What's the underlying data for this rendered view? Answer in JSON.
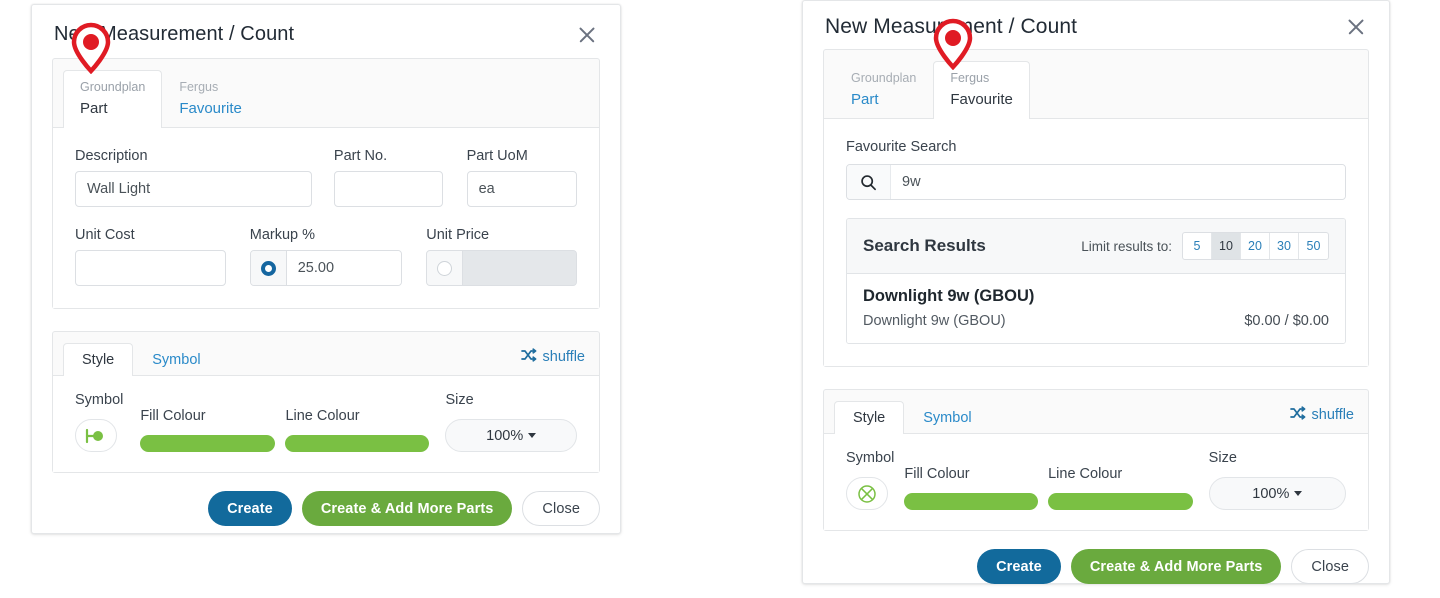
{
  "left_panel": {
    "title": "New Measurement / Count",
    "close_icon": "close-icon",
    "tabs": [
      {
        "sub": "Groundplan",
        "main": "Part",
        "active": true
      },
      {
        "sub": "Fergus",
        "main": "Favourite",
        "active": false
      }
    ],
    "form": {
      "description_label": "Description",
      "description_value": "Wall Light",
      "part_no_label": "Part No.",
      "part_no_value": "",
      "part_uom_label": "Part UoM",
      "part_uom_value": "ea",
      "unit_cost_label": "Unit Cost",
      "unit_cost_value": "",
      "markup_label": "Markup %",
      "markup_value": "25.00",
      "markup_selected": true,
      "unit_price_label": "Unit Price",
      "unit_price_value": "",
      "unit_price_selected": false,
      "unit_price_disabled": true
    },
    "style": {
      "tab_style": "Style",
      "tab_symbol": "Symbol",
      "shuffle_label": "shuffle",
      "shuffle_icon": "shuffle-icon",
      "symbol_label": "Symbol",
      "symbol_icon": "line-dot-symbol-icon",
      "fill_label": "Fill Colour",
      "fill_colour": "#7AC043",
      "line_label": "Line Colour",
      "line_colour": "#7AC043",
      "size_label": "Size",
      "size_value": "100%"
    },
    "footer": {
      "create": "Create",
      "create_add": "Create & Add More Parts",
      "close": "Close"
    }
  },
  "right_panel": {
    "title": "New Measurement / Count",
    "close_icon": "close-icon",
    "tabs": [
      {
        "sub": "Groundplan",
        "main": "Part",
        "active": false
      },
      {
        "sub": "Fergus",
        "main": "Favourite",
        "active": true
      }
    ],
    "search": {
      "label": "Favourite Search",
      "icon": "search-icon",
      "value": "9w",
      "placeholder": ""
    },
    "results": {
      "title": "Search Results",
      "limit_label": "Limit results to:",
      "limit_options": [
        "5",
        "10",
        "20",
        "30",
        "50"
      ],
      "limit_selected": "10",
      "items": [
        {
          "name": "Downlight 9w (GBOU)",
          "description": "Downlight 9w (GBOU)",
          "price": "$0.00 / $0.00"
        }
      ]
    },
    "style": {
      "tab_style": "Style",
      "tab_symbol": "Symbol",
      "shuffle_label": "shuffle",
      "shuffle_icon": "shuffle-icon",
      "symbol_label": "Symbol",
      "symbol_icon": "crossed-circle-symbol-icon",
      "fill_label": "Fill Colour",
      "fill_colour": "#7AC043",
      "line_label": "Line Colour",
      "line_colour": "#7AC043",
      "size_label": "Size",
      "size_value": "100%"
    },
    "footer": {
      "create": "Create",
      "create_add": "Create & Add More Parts",
      "close": "Close"
    }
  },
  "annotations": {
    "pin_icon": "map-pin-marker-icon",
    "pin_colour": "#E01B24"
  },
  "theme": {
    "primary_blue": "#126A9C",
    "green": "#6AAA3E",
    "swatch_green": "#7AC043",
    "link_blue": "#2A8AC9"
  }
}
